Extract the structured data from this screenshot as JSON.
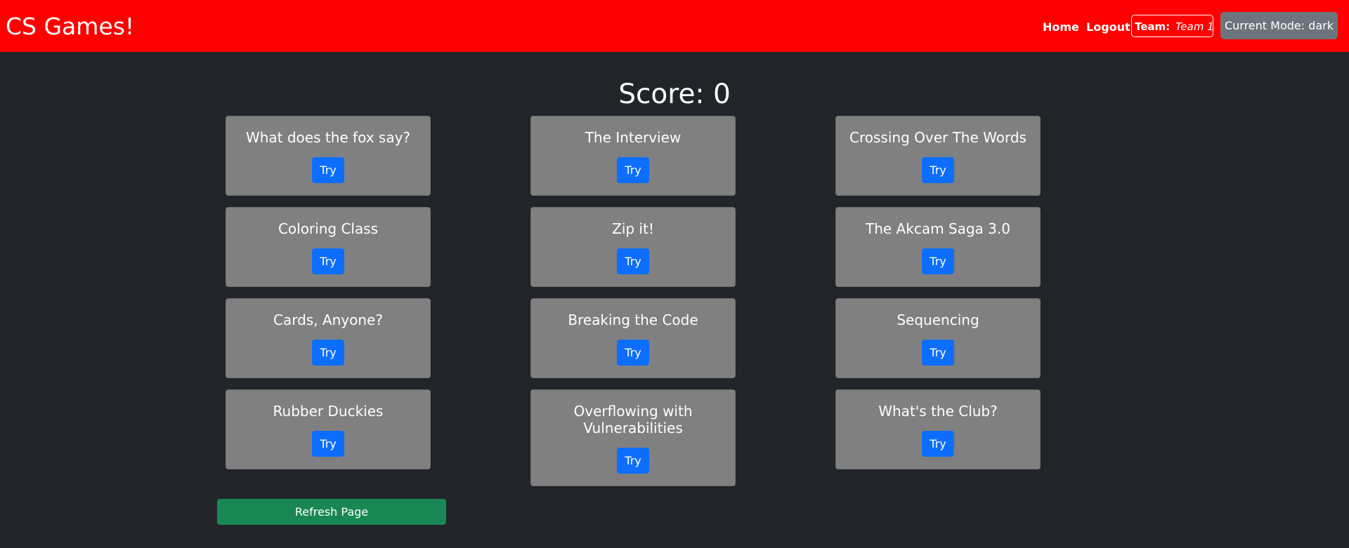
{
  "navbar": {
    "brand": "CS Games!",
    "home": "Home",
    "logout": "Logout",
    "team_label": "Team:",
    "team_name": "Team 1",
    "mode_button": "Current Mode: dark",
    "background_color": "#ff0000"
  },
  "score": {
    "text": "Score: 0"
  },
  "challenges": [
    {
      "title": "What does the fox say?",
      "button": "Try"
    },
    {
      "title": "The Interview",
      "button": "Try"
    },
    {
      "title": "Crossing Over The Words",
      "button": "Try"
    },
    {
      "title": "Coloring Class",
      "button": "Try"
    },
    {
      "title": "Zip it!",
      "button": "Try"
    },
    {
      "title": "The Akcam Saga 3.0",
      "button": "Try"
    },
    {
      "title": "Cards, Anyone?",
      "button": "Try"
    },
    {
      "title": "Breaking the Code",
      "button": "Try"
    },
    {
      "title": "Sequencing",
      "button": "Try"
    },
    {
      "title": "Rubber Duckies",
      "button": "Try"
    },
    {
      "title": "Overflowing with Vulnerabilities",
      "button": "Try"
    },
    {
      "title": "What's the Club?",
      "button": "Try"
    }
  ],
  "refresh_button": "Refresh Page",
  "colors": {
    "page_background": "#212529",
    "card_background": "#808080",
    "try_button": "#0d6efd",
    "refresh_button": "#198754",
    "mode_button": "#6c757d"
  }
}
